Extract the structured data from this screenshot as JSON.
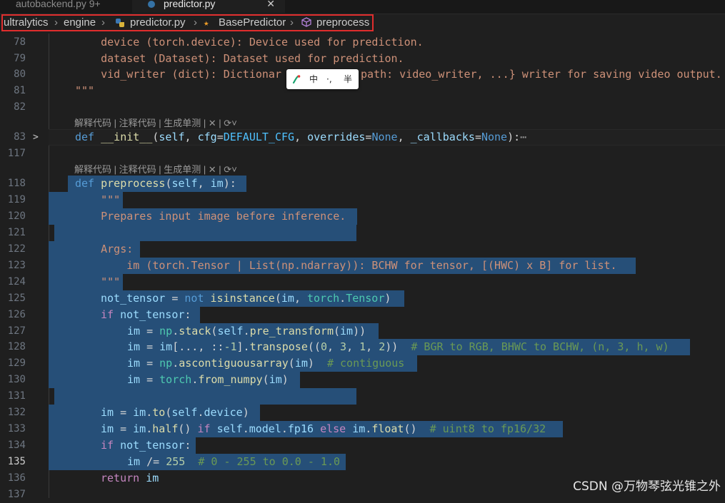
{
  "tabs": [
    {
      "label": "autobackend.py 9+"
    },
    {
      "label": "predictor.py",
      "close": "✕"
    }
  ],
  "breadcrumb": {
    "items": [
      "ultralytics",
      "engine",
      "predictor.py",
      "BasePredictor",
      "preprocess"
    ],
    "separator": "›"
  },
  "codelens": {
    "text": "解释代码 | 注释代码 | 生成单测 | ✕ | ⟳˅"
  },
  "ime": {
    "mode": "中",
    "punct": "·,",
    "width": "半"
  },
  "lines": [
    {
      "n": "78"
    },
    {
      "n": "79"
    },
    {
      "n": "80"
    },
    {
      "n": "81"
    },
    {
      "n": "82"
    },
    {
      "n": "83"
    },
    {
      "n": "117"
    },
    {
      "n": "118"
    },
    {
      "n": "119"
    },
    {
      "n": "120"
    },
    {
      "n": "121"
    },
    {
      "n": "122"
    },
    {
      "n": "123"
    },
    {
      "n": "124"
    },
    {
      "n": "125"
    },
    {
      "n": "126"
    },
    {
      "n": "127"
    },
    {
      "n": "128"
    },
    {
      "n": "129"
    },
    {
      "n": "130"
    },
    {
      "n": "131"
    },
    {
      "n": "132"
    },
    {
      "n": "133"
    },
    {
      "n": "134"
    },
    {
      "n": "135"
    },
    {
      "n": "136"
    },
    {
      "n": "137"
    }
  ],
  "code": {
    "l78": "    device (torch.device): Device used for prediction.",
    "l79": "    dataset (Dataset): Dataset used for prediction.",
    "l80a": "    vid_writer (dict): Dictionar",
    "l80b": "path: video_writer, ...} writer for saving video output.",
    "l81": "\"\"\"",
    "l83_def": "def",
    "l83_fn": "__init__",
    "l83_rest1": "(",
    "l83_self": "self",
    "l83_c1": ", ",
    "l83_cfg": "cfg",
    "l83_eq1": "=",
    "l83_dc": "DEFAULT_CFG",
    "l83_c2": ", ",
    "l83_ov": "overrides",
    "l83_eq2": "=",
    "l83_none1": "None",
    "l83_c3": ", ",
    "l83_cb": "_callbacks",
    "l83_eq3": "=",
    "l83_none2": "None",
    "l83_end": "):",
    "l83_more": "⋯",
    "l118_def": "def",
    "l118_fn": "preprocess",
    "l118_p1": "(",
    "l118_self": "self",
    "l118_c": ", ",
    "l118_im": "im",
    "l118_end": "):",
    "l119": "    \"\"\"",
    "l120": "    Prepares input image before inference.",
    "l122": "    Args:",
    "l123": "        im (torch.Tensor | List(np.ndarray)): BCHW for tensor, [(HWC) x B] for list.",
    "l124": "    \"\"\"",
    "l125_a": "not_tensor",
    "l125_b": " = ",
    "l125_c": "not",
    "l125_d": " ",
    "l125_e": "isinstance",
    "l125_f": "(",
    "l125_g": "im",
    "l125_h": ", ",
    "l125_i": "torch",
    "l125_j": ".",
    "l125_k": "Tensor",
    "l125_l": ")",
    "l126_if": "if",
    "l126_v": " not_tensor",
    "l126_c": ":",
    "l127_im": "im",
    "l127_eq": " = ",
    "l127_np": "np",
    "l127_dot": ".",
    "l127_fn": "stack",
    "l127_p": "(",
    "l127_self": "self",
    "l127_d2": ".",
    "l127_fn2": "pre_transform",
    "l127_p2": "(",
    "l127_im2": "im",
    "l127_end": "))",
    "l128_im": "im",
    "l128_eq": " = ",
    "l128_im2": "im",
    "l128_sl": "[..., ::",
    "l128_n1": "-1",
    "l128_sl2": "].",
    "l128_fn": "transpose",
    "l128_p": "((",
    "l128_n2": "0",
    "l128_c1": ", ",
    "l128_n3": "3",
    "l128_c2": ", ",
    "l128_n4": "1",
    "l128_c3": ", ",
    "l128_n5": "2",
    "l128_end": "))  ",
    "l128_cm": "# BGR to RGB, BHWC to BCHW, (n, 3, h, w)",
    "l129_im": "im",
    "l129_eq": " = ",
    "l129_np": "np",
    "l129_dot": ".",
    "l129_fn": "ascontiguousarray",
    "l129_p": "(",
    "l129_im2": "im",
    "l129_end": ")  ",
    "l129_cm": "# contiguous",
    "l130_im": "im",
    "l130_eq": " = ",
    "l130_t": "torch",
    "l130_dot": ".",
    "l130_fn": "from_numpy",
    "l130_p": "(",
    "l130_im2": "im",
    "l130_end": ")",
    "l132_im": "im",
    "l132_eq": " = ",
    "l132_im2": "im",
    "l132_dot": ".",
    "l132_fn": "to",
    "l132_p": "(",
    "l132_self": "self",
    "l132_d2": ".",
    "l132_dev": "device",
    "l132_end": ")",
    "l133_im": "im",
    "l133_eq": " = ",
    "l133_im2": "im",
    "l133_dot": ".",
    "l133_fn": "half",
    "l133_pe": "() ",
    "l133_if": "if",
    "l133_sp": " ",
    "l133_self": "self",
    "l133_d2": ".",
    "l133_model": "model",
    "l133_d3": ".",
    "l133_fp": "fp16",
    "l133_sp2": " ",
    "l133_else": "else",
    "l133_sp3": " ",
    "l133_im3": "im",
    "l133_d4": ".",
    "l133_fn2": "float",
    "l133_end": "()  ",
    "l133_cm": "# uint8 to fp16/32",
    "l134_if": "if",
    "l134_v": " not_tensor",
    "l134_c": ":",
    "l135_im": "im",
    "l135_op": " /= ",
    "l135_n": "255",
    "l135_sp": "  ",
    "l135_cm": "# 0 - 255 to 0.0 - 1.0",
    "l136_ret": "return",
    "l136_im": " im"
  },
  "watermark": "CSDN @万物琴弦光锥之外",
  "colors": {
    "selection": "#264f78",
    "highlight_box": "#e02d2d",
    "editor_bg": "#1f1f1f"
  }
}
